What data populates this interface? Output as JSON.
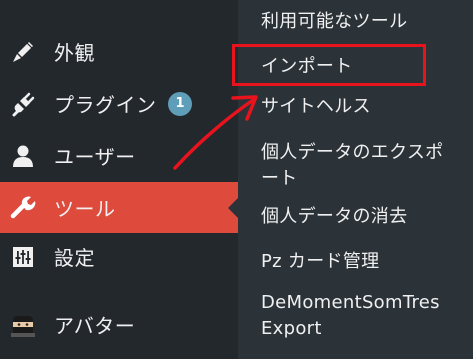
{
  "menu": {
    "appearance": {
      "label": "外観",
      "icon": "brush-icon"
    },
    "plugins": {
      "label": "プラグイン",
      "badge": "1",
      "icon": "plug-icon"
    },
    "users": {
      "label": "ユーザー",
      "icon": "user-icon"
    },
    "tools": {
      "label": "ツール",
      "icon": "wrench-icon",
      "active": true
    },
    "settings": {
      "label": "設定",
      "icon": "sliders-icon"
    },
    "avatar": {
      "label": "アバター",
      "icon": "ninja-avatar-icon"
    }
  },
  "submenu": {
    "title": "利用可能なツール",
    "import": "インポート",
    "site_health": "サイトヘルス",
    "export_line1": "個人データのエクスポ",
    "export_line2": "ート",
    "erase": "個人データの消去",
    "pz": "Pz カード管理",
    "demoment_line1": "DeMomentSomTres",
    "demoment_line2": "Export"
  },
  "colors": {
    "menu_bg": "#23282d",
    "submenu_bg": "#2c3338",
    "active_bg": "#de4a3b",
    "badge_bg": "#5f9eb8",
    "annotation_red": "#e8131d"
  }
}
